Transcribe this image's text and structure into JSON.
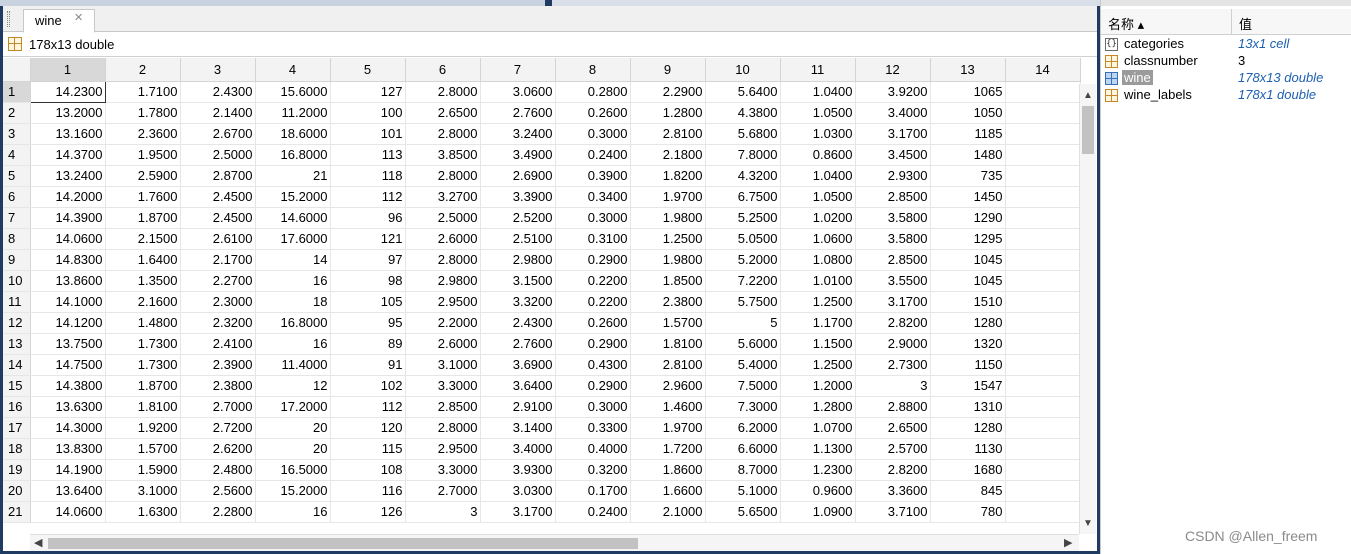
{
  "editor": {
    "tab_label": "wine",
    "tab_close_glyph": "✕",
    "variable_info": "178x13 double"
  },
  "table": {
    "column_headers": [
      "1",
      "2",
      "3",
      "4",
      "5",
      "6",
      "7",
      "8",
      "9",
      "10",
      "11",
      "12",
      "13",
      "14"
    ],
    "selected_column": "1",
    "selected_row": "1",
    "rows": [
      {
        "n": "1",
        "v": [
          "14.2300",
          "1.7100",
          "2.4300",
          "15.6000",
          "127",
          "2.8000",
          "3.0600",
          "0.2800",
          "2.2900",
          "5.6400",
          "1.0400",
          "3.9200",
          "1065",
          ""
        ]
      },
      {
        "n": "2",
        "v": [
          "13.2000",
          "1.7800",
          "2.1400",
          "11.2000",
          "100",
          "2.6500",
          "2.7600",
          "0.2600",
          "1.2800",
          "4.3800",
          "1.0500",
          "3.4000",
          "1050",
          ""
        ]
      },
      {
        "n": "3",
        "v": [
          "13.1600",
          "2.3600",
          "2.6700",
          "18.6000",
          "101",
          "2.8000",
          "3.2400",
          "0.3000",
          "2.8100",
          "5.6800",
          "1.0300",
          "3.1700",
          "1185",
          ""
        ]
      },
      {
        "n": "4",
        "v": [
          "14.3700",
          "1.9500",
          "2.5000",
          "16.8000",
          "113",
          "3.8500",
          "3.4900",
          "0.2400",
          "2.1800",
          "7.8000",
          "0.8600",
          "3.4500",
          "1480",
          ""
        ]
      },
      {
        "n": "5",
        "v": [
          "13.2400",
          "2.5900",
          "2.8700",
          "21",
          "118",
          "2.8000",
          "2.6900",
          "0.3900",
          "1.8200",
          "4.3200",
          "1.0400",
          "2.9300",
          "735",
          ""
        ]
      },
      {
        "n": "6",
        "v": [
          "14.2000",
          "1.7600",
          "2.4500",
          "15.2000",
          "112",
          "3.2700",
          "3.3900",
          "0.3400",
          "1.9700",
          "6.7500",
          "1.0500",
          "2.8500",
          "1450",
          ""
        ]
      },
      {
        "n": "7",
        "v": [
          "14.3900",
          "1.8700",
          "2.4500",
          "14.6000",
          "96",
          "2.5000",
          "2.5200",
          "0.3000",
          "1.9800",
          "5.2500",
          "1.0200",
          "3.5800",
          "1290",
          ""
        ]
      },
      {
        "n": "8",
        "v": [
          "14.0600",
          "2.1500",
          "2.6100",
          "17.6000",
          "121",
          "2.6000",
          "2.5100",
          "0.3100",
          "1.2500",
          "5.0500",
          "1.0600",
          "3.5800",
          "1295",
          ""
        ]
      },
      {
        "n": "9",
        "v": [
          "14.8300",
          "1.6400",
          "2.1700",
          "14",
          "97",
          "2.8000",
          "2.9800",
          "0.2900",
          "1.9800",
          "5.2000",
          "1.0800",
          "2.8500",
          "1045",
          ""
        ]
      },
      {
        "n": "10",
        "v": [
          "13.8600",
          "1.3500",
          "2.2700",
          "16",
          "98",
          "2.9800",
          "3.1500",
          "0.2200",
          "1.8500",
          "7.2200",
          "1.0100",
          "3.5500",
          "1045",
          ""
        ]
      },
      {
        "n": "11",
        "v": [
          "14.1000",
          "2.1600",
          "2.3000",
          "18",
          "105",
          "2.9500",
          "3.3200",
          "0.2200",
          "2.3800",
          "5.7500",
          "1.2500",
          "3.1700",
          "1510",
          ""
        ]
      },
      {
        "n": "12",
        "v": [
          "14.1200",
          "1.4800",
          "2.3200",
          "16.8000",
          "95",
          "2.2000",
          "2.4300",
          "0.2600",
          "1.5700",
          "5",
          "1.1700",
          "2.8200",
          "1280",
          ""
        ]
      },
      {
        "n": "13",
        "v": [
          "13.7500",
          "1.7300",
          "2.4100",
          "16",
          "89",
          "2.6000",
          "2.7600",
          "0.2900",
          "1.8100",
          "5.6000",
          "1.1500",
          "2.9000",
          "1320",
          ""
        ]
      },
      {
        "n": "14",
        "v": [
          "14.7500",
          "1.7300",
          "2.3900",
          "11.4000",
          "91",
          "3.1000",
          "3.6900",
          "0.4300",
          "2.8100",
          "5.4000",
          "1.2500",
          "2.7300",
          "1150",
          ""
        ]
      },
      {
        "n": "15",
        "v": [
          "14.3800",
          "1.8700",
          "2.3800",
          "12",
          "102",
          "3.3000",
          "3.6400",
          "0.2900",
          "2.9600",
          "7.5000",
          "1.2000",
          "3",
          "1547",
          ""
        ]
      },
      {
        "n": "16",
        "v": [
          "13.6300",
          "1.8100",
          "2.7000",
          "17.2000",
          "112",
          "2.8500",
          "2.9100",
          "0.3000",
          "1.4600",
          "7.3000",
          "1.2800",
          "2.8800",
          "1310",
          ""
        ]
      },
      {
        "n": "17",
        "v": [
          "14.3000",
          "1.9200",
          "2.7200",
          "20",
          "120",
          "2.8000",
          "3.1400",
          "0.3300",
          "1.9700",
          "6.2000",
          "1.0700",
          "2.6500",
          "1280",
          ""
        ]
      },
      {
        "n": "18",
        "v": [
          "13.8300",
          "1.5700",
          "2.6200",
          "20",
          "115",
          "2.9500",
          "3.4000",
          "0.4000",
          "1.7200",
          "6.6000",
          "1.1300",
          "2.5700",
          "1130",
          ""
        ]
      },
      {
        "n": "19",
        "v": [
          "14.1900",
          "1.5900",
          "2.4800",
          "16.5000",
          "108",
          "3.3000",
          "3.9300",
          "0.3200",
          "1.8600",
          "8.7000",
          "1.2300",
          "2.8200",
          "1680",
          ""
        ]
      },
      {
        "n": "20",
        "v": [
          "13.6400",
          "3.1000",
          "2.5600",
          "15.2000",
          "116",
          "2.7000",
          "3.0300",
          "0.1700",
          "1.6600",
          "5.1000",
          "0.9600",
          "3.3600",
          "845",
          ""
        ]
      },
      {
        "n": "21",
        "v": [
          "14.0600",
          "1.6300",
          "2.2800",
          "16",
          "126",
          "3",
          "3.1700",
          "0.2400",
          "2.1000",
          "5.6500",
          "1.0900",
          "3.7100",
          "780",
          ""
        ]
      }
    ]
  },
  "scrollbars": {
    "up_glyph": "▲",
    "down_glyph": "▼",
    "left_glyph": "◀",
    "right_glyph": "▶"
  },
  "workspace": {
    "col_name": "名称 ▴",
    "col_value": "值",
    "variables": [
      {
        "name": "categories",
        "value": "13x1 cell",
        "icon": "cell-icon",
        "selected": false,
        "italic": true
      },
      {
        "name": "classnumber",
        "value": "3",
        "icon": "grid-icon",
        "selected": false,
        "italic": false
      },
      {
        "name": "wine",
        "value": "178x13 double",
        "icon": "grid-icon-blue",
        "selected": true,
        "italic": true
      },
      {
        "name": "wine_labels",
        "value": "178x1 double",
        "icon": "grid-icon",
        "selected": false,
        "italic": true
      }
    ]
  },
  "watermark": "CSDN @Allen_freem",
  "colors": {
    "frame": "#1f3b63",
    "value_blue": "#1d5fb0",
    "selection_gray": "#9b9b9b"
  }
}
